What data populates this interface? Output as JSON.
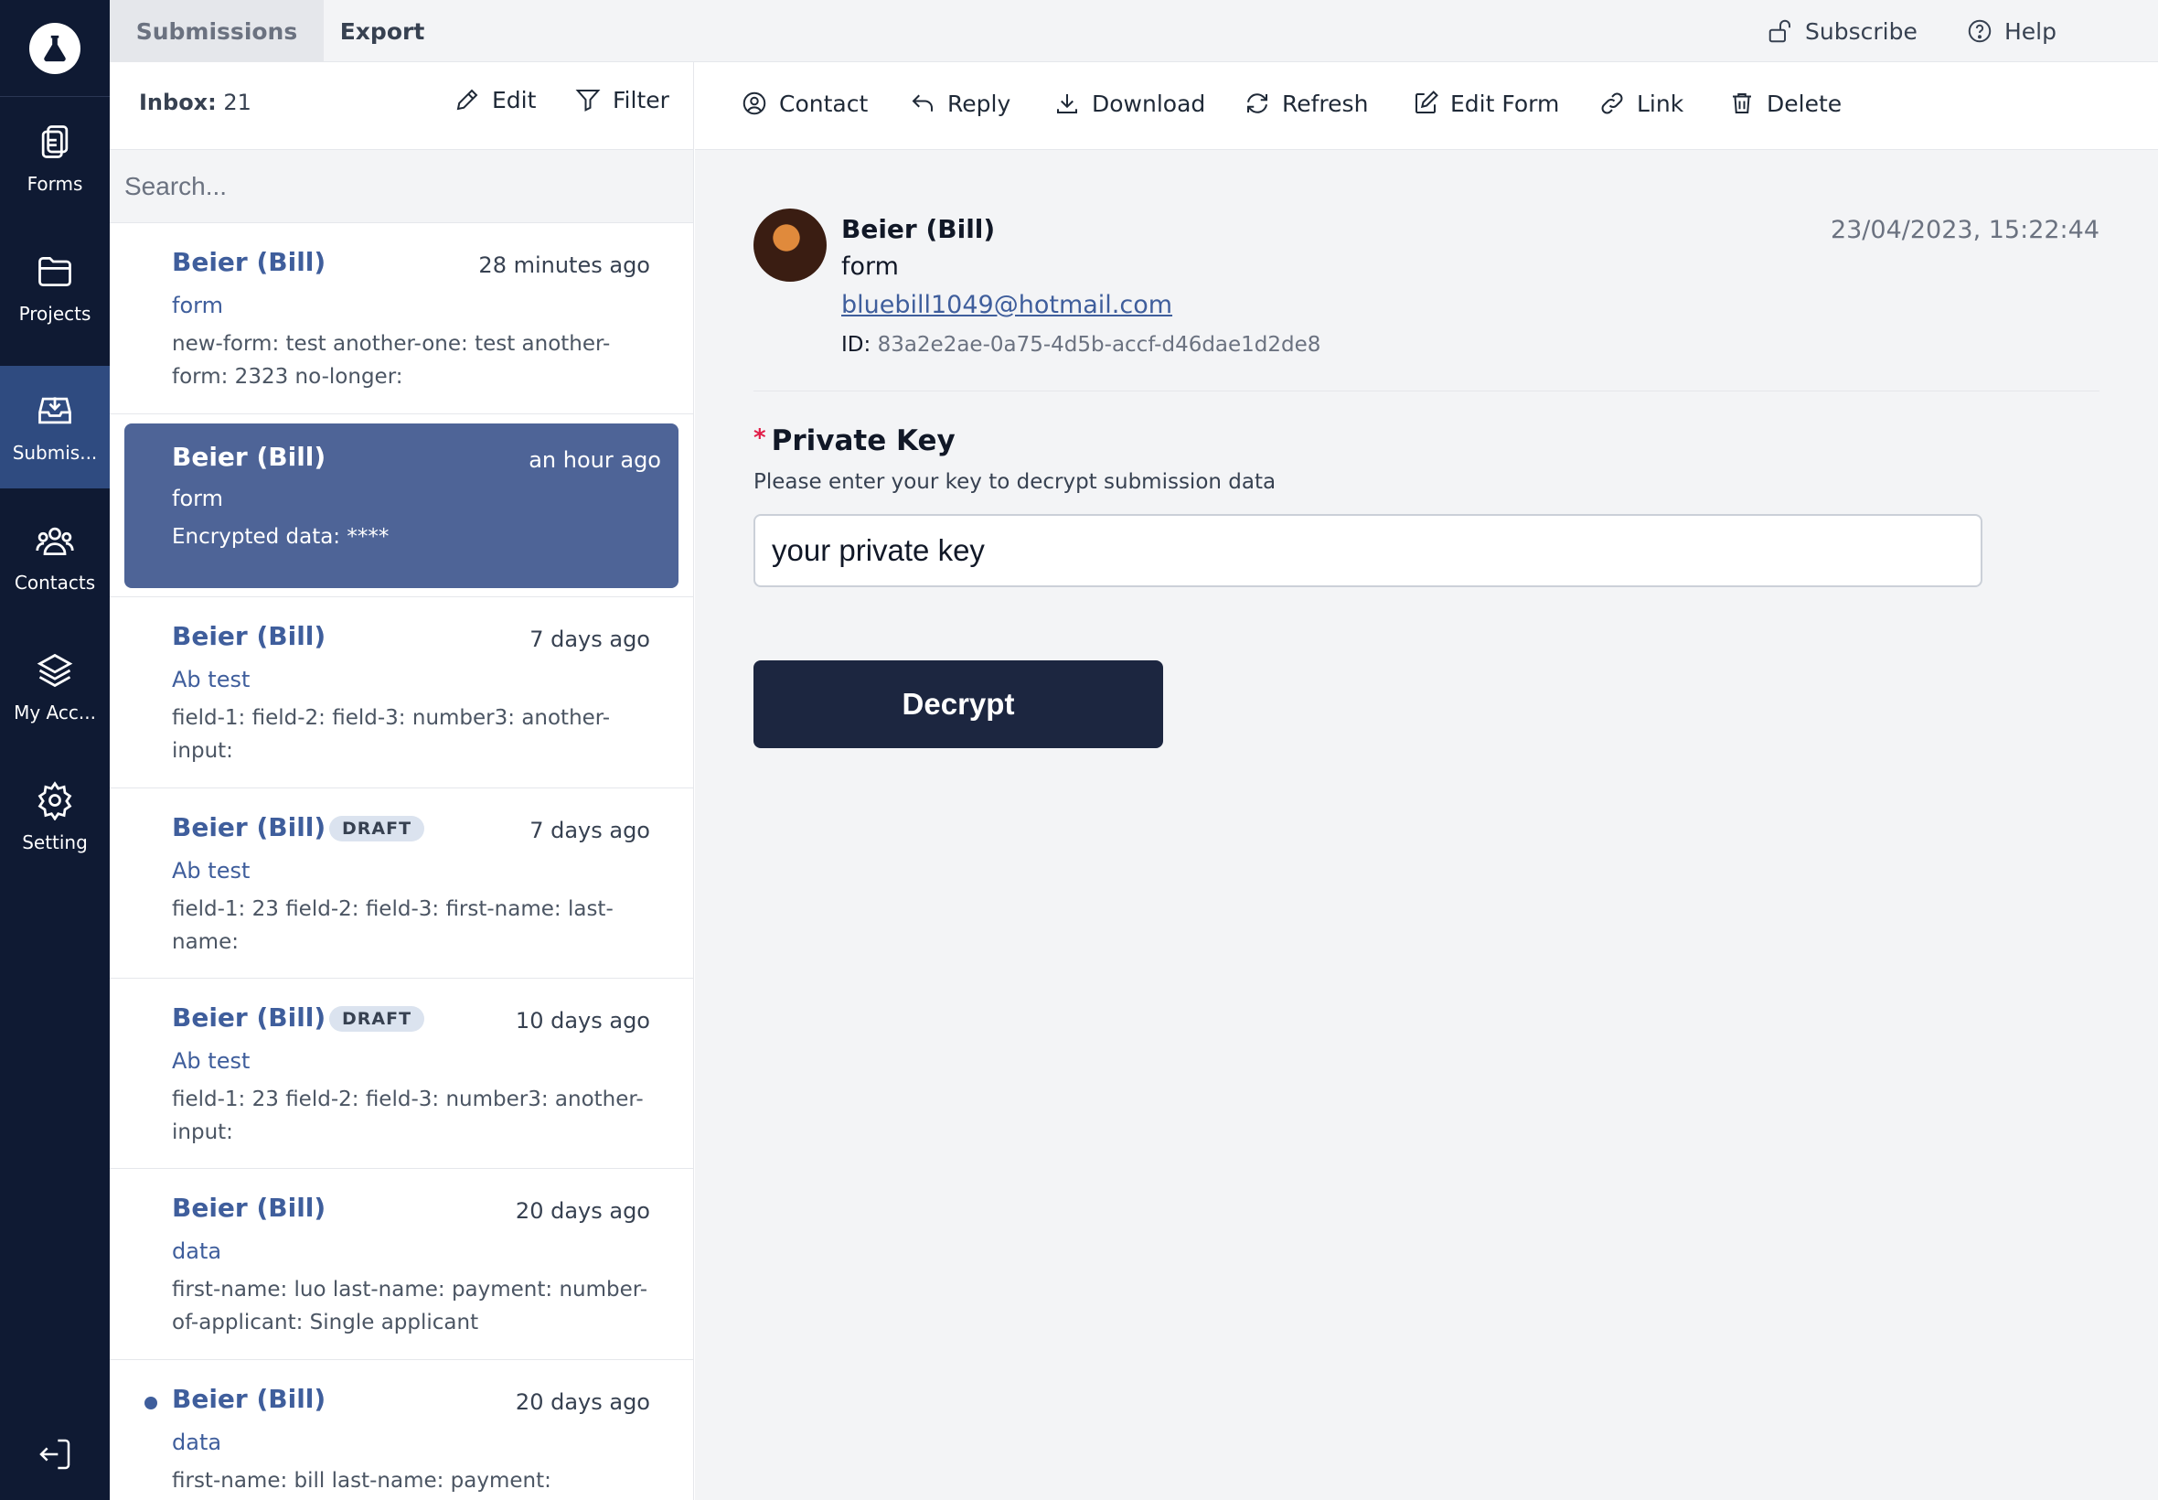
{
  "nav": {
    "items": [
      {
        "label": "Forms"
      },
      {
        "label": "Projects"
      },
      {
        "label": "Submis..."
      },
      {
        "label": "Contacts"
      },
      {
        "label": "My Acc..."
      },
      {
        "label": "Setting"
      }
    ]
  },
  "topbar": {
    "tabs": [
      "Submissions",
      "Export"
    ],
    "subscribe": "Subscribe",
    "help": "Help"
  },
  "list": {
    "inbox_label": "Inbox:",
    "inbox_count": "21",
    "edit": "Edit",
    "filter": "Filter",
    "search_placeholder": "Search...",
    "items": [
      {
        "name": "Beier (Bill)",
        "time": "28 minutes ago",
        "form": "form",
        "summary": "new-form: test another-one: test another-form: 2323 no-longer:"
      },
      {
        "name": "Beier (Bill)",
        "time": "an hour ago",
        "form": "form",
        "summary": "Encrypted data: ****"
      },
      {
        "name": "Beier (Bill)",
        "time": "7 days ago",
        "form": "Ab test",
        "summary": "field-1: field-2: field-3: number3: another-input:"
      },
      {
        "name": "Beier (Bill)",
        "badge": "DRAFT",
        "time": "7 days ago",
        "form": "Ab test",
        "summary": "field-1: 23 field-2: field-3: first-name: last-name:"
      },
      {
        "name": "Beier (Bill)",
        "badge": "DRAFT",
        "time": "10 days ago",
        "form": "Ab test",
        "summary": "field-1: 23 field-2: field-3: number3: another-input:"
      },
      {
        "name": "Beier (Bill)",
        "time": "20 days ago",
        "form": "data",
        "summary": "first-name: luo last-name: payment: number-of-applicant: Single applicant"
      },
      {
        "name": "Beier (Bill)",
        "time": "20 days ago",
        "form": "data",
        "summary": "first-name: bill last-name: payment:"
      }
    ]
  },
  "actions": {
    "contact": "Contact",
    "reply": "Reply",
    "download": "Download",
    "refresh": "Refresh",
    "edit_form": "Edit Form",
    "link": "Link",
    "delete": "Delete"
  },
  "detail": {
    "name": "Beier (Bill)",
    "form": "form",
    "email": "bluebill1049@hotmail.com",
    "id_label": "ID:",
    "id": "83a2e2ae-0a75-4d5b-accf-d46dae1d2de8",
    "date": "23/04/2023, 15:22:44",
    "required_mark": "*",
    "key_label": "Private Key",
    "key_description": "Please enter your key to decrypt submission data",
    "key_value": "your private key",
    "decrypt_button": "Decrypt"
  }
}
